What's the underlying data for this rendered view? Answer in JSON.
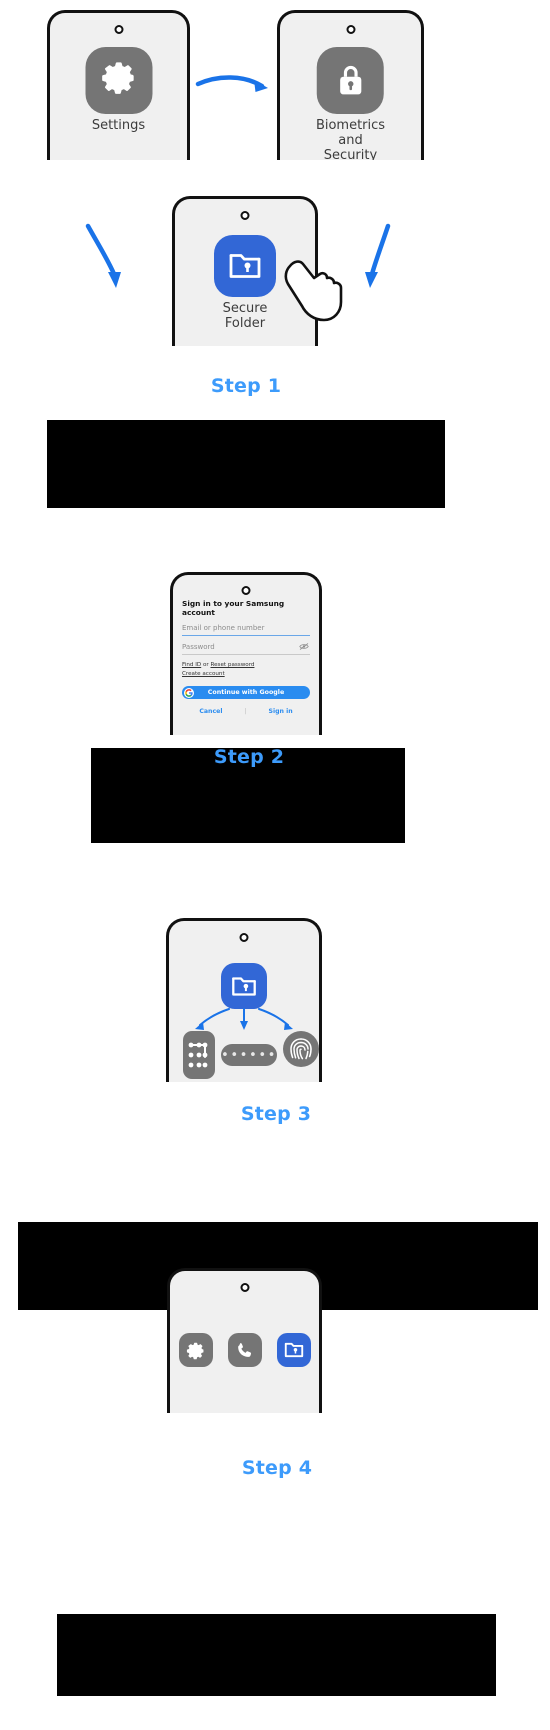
{
  "meta": {
    "title": "How to set up Samsung Secure Folder",
    "accent_blue": "#3d9bfb",
    "arrow_blue": "#1a73e8",
    "icon_grey": "#757575",
    "icon_blue": "#3267d6",
    "redaction_black": "#000000"
  },
  "row1": {
    "settings": {
      "label": "Settings",
      "icon": "gear-icon"
    },
    "biometrics": {
      "label": "Biometrics\nand Security",
      "label_line1": "Biometrics",
      "label_line2": "and Security",
      "icon": "padlock-icon"
    },
    "arrow": "arrow-right-icon"
  },
  "row2": {
    "secure_folder": {
      "label": "Secure Folder",
      "icon": "secure-folder-icon"
    },
    "hand": "tapping-hand-icon",
    "arrow_left": "curved-arrow-down-left-icon",
    "arrow_right": "curved-arrow-down-right-icon"
  },
  "steps": [
    {
      "label": "Step 1"
    },
    {
      "label": "Step 2"
    },
    {
      "label": "Step 3"
    },
    {
      "label": "Step 4"
    }
  ],
  "signin_screen": {
    "title": "Sign in to your Samsung account",
    "email_placeholder": "Email or phone number",
    "password_placeholder": "Password",
    "show_password_icon": "eye-slash-icon",
    "find_id": "Find ID",
    "or_text": " or ",
    "reset_password": "Reset password",
    "create_account": "Create account",
    "google_button": "Continue with Google",
    "google_icon": "google-g-icon",
    "cancel": "Cancel",
    "separator": "|",
    "sign_in": "Sign in"
  },
  "lock_screen": {
    "folder_icon": "secure-folder-icon",
    "methods": [
      {
        "name": "pattern-lock-icon"
      },
      {
        "name": "pin-lock-icon",
        "dots": "••••••"
      },
      {
        "name": "fingerprint-icon"
      }
    ]
  },
  "drawer_screen": {
    "apps": [
      {
        "icon": "gear-icon"
      },
      {
        "icon": "phone-icon"
      },
      {
        "icon": "secure-folder-icon"
      }
    ]
  }
}
